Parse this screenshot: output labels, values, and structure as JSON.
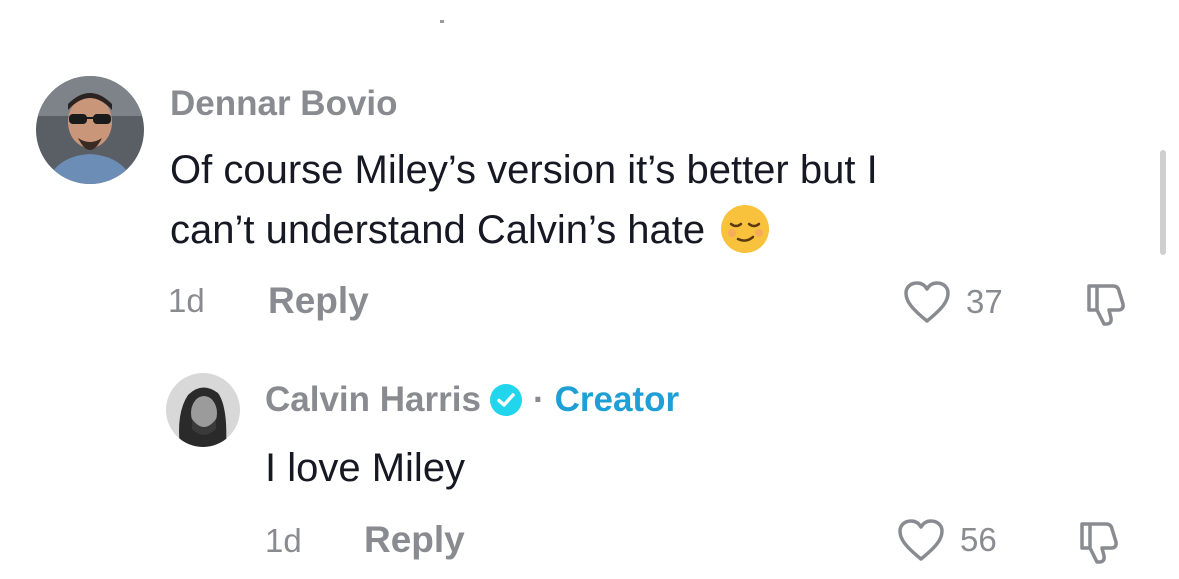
{
  "comments": [
    {
      "author": "Dennar Bovio",
      "text_line1": "Of course Miley’s version it’s better but I",
      "text_line2": "can’t understand Calvin’s hate",
      "time": "1d",
      "reply_label": "Reply",
      "likes": "37",
      "emoji": "relieved-face"
    },
    {
      "author": "Calvin Harris",
      "separator": "·",
      "badge": "Creator",
      "text": "I love Miley",
      "time": "1d",
      "reply_label": "Reply",
      "likes": "56"
    }
  ],
  "colors": {
    "muted": "#8a8b91",
    "text": "#161823",
    "creator": "#1e9fd6",
    "verified": "#20d5ec"
  }
}
